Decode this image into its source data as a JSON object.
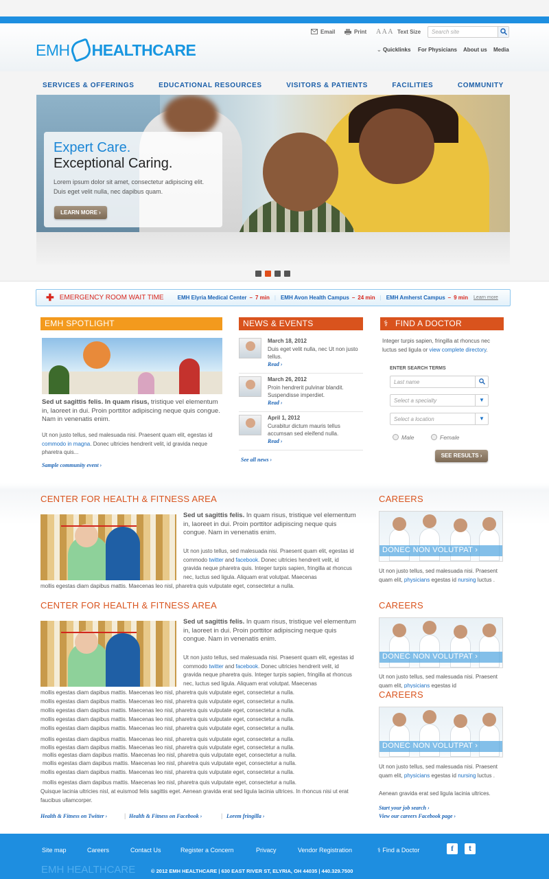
{
  "header": {
    "logo_left": "EMH",
    "logo_right": "HEALTHCARE",
    "email": "Email",
    "print": "Print",
    "text_size_glyphs": "A A A",
    "text_size": "Text Size",
    "search_placeholder": "Search site",
    "quicklinks": "Quicklinks",
    "for_physicians": "For Physicians",
    "about_us": "About us",
    "media": "Media"
  },
  "nav": [
    "SERVICES & OFFERINGS",
    "EDUCATIONAL RESOURCES",
    "VISITORS & PATIENTS",
    "FACILITIES",
    "COMMUNITY"
  ],
  "hero": {
    "title1": "Expert Care.",
    "title2": "Exceptional Caring.",
    "body": "Lorem ipsum dolor sit amet, consectetur adipiscing elit. Duis eget velit nulla, nec dapibus quam.",
    "button": "LEARN MORE",
    "slides": 4,
    "active_slide": 2
  },
  "er": {
    "title": "EMERGENCY ROOM WAIT TIME",
    "campuses": [
      {
        "name": "EMH Elyria Medical Center",
        "time": "7 min"
      },
      {
        "name": "EMH Avon Health Campus",
        "time": "24 min"
      },
      {
        "name": "EMH Amherst Campus",
        "time": "9 min"
      }
    ],
    "learn_more": "Learn more"
  },
  "spotlight": {
    "title": "EMH SPOTLIGHT",
    "lead_bold": "Sed ut sagittis felis. In quam risus,",
    "lead_rest": " tristique vel elementum in, laoreet in dui. Proin porttitor adipiscing neque quis congue. Nam in venenatis enim.",
    "body_pre": "Ut non justo tellus, sed malesuada nisi. Praesent quam elit, egestas id ",
    "body_link": "commodo in magna",
    "body_post": ". Donec ultricies hendrerit velit, id gravida neque pharetra quis...",
    "event_link": "Sample community event ›"
  },
  "news": {
    "title": "NEWS & EVENTS",
    "items": [
      {
        "date": "March 18, 2012",
        "text": "Duis eget velit nulla, nec Ut non justo tellus.",
        "read": "Read ›"
      },
      {
        "date": "March 26, 2012",
        "text": "Proin hendrerit pulvinar blandit. Suspendisse imperdiet.",
        "read": "Read ›"
      },
      {
        "date": "April 1, 2012",
        "text": "Curabitur dictum mauris tellus accumsan sed eleifend nulla.",
        "read": "Read ›"
      }
    ],
    "see_all": "See all news ›"
  },
  "doctor": {
    "title": "FIND A DOCTOR",
    "intro_pre": "Integer turpis sapien, fringilla at rhoncus nec luctus sed ligula or ",
    "intro_link": "view complete directory",
    "intro_post": ".",
    "search_terms": "ENTER SEARCH TERMS",
    "last_name": "Last name",
    "specialty": "Select a specialty",
    "location": "Select a location",
    "male": "Male",
    "female": "Female",
    "button": "SEE RESULTS"
  },
  "fitness": {
    "title": "CENTER FOR HEALTH & FITNESS AREA",
    "lead_bold": "Sed ut sagittis felis.",
    "lead_rest": " In quam risus, tristique vel elementum in, laoreet in dui. Proin porttitor adipiscing neque quis congue. Nam in venenatis enim.",
    "p_pre": "Ut non justo tellus, sed malesuada nisi. Praesent quam elit, egestas id commodo ",
    "twitter": "twitter",
    "and": " and ",
    "facebook": "facebook",
    "p_post": ". Donec ultricies hendrerit velit, id gravida neque pharetra quis. Integer turpis sapien, fringilla at rhoncus nec, luctus sed ligula. Aliquam erat volutpat. Maecenas",
    "full_line": "mollis egestas diam dapibus mattis. Maecenas leo nisl, pharetra quis vulputate eget, consectetur a nulla.",
    "tail": "Quisque lacinia ultricies nisl, at euismod felis sagittis eget. Aenean gravida erat sed ligula lacinia ultrices. In rhoncus nisi ut erat faucibus ullamcorper.",
    "links": [
      "Health & Fitness on Twitter ›",
      "Health & Fitness on Facebook ›",
      "Lorem fringilla ›"
    ]
  },
  "careers": {
    "title": "CAREERS",
    "banner": "DONEC NON VOLUTPAT ›",
    "p_pre": "Ut non justo tellus, sed malesuada nisi. Praesent quam elit, ",
    "physicians": "physicians",
    "p_mid": " egestas id ",
    "nursing": "nursing",
    "p_post": " luctus .",
    "cut": "Praesent quam elit, physicians egestas id",
    "extra": "Aenean gravida erat sed ligula lacinia ultrices.",
    "job_link": "Start your job search ›",
    "fb_link": "View our careers Facebook page ›"
  },
  "footer": {
    "links": [
      "Site map",
      "Careers",
      "Contact Us",
      "Register a Concern",
      "Privacy",
      "Vendor Registration",
      "Find a Doctor"
    ],
    "logo": "EMH HEALTHCARE",
    "copyright": "© 2012 EMH HEALTHCARE  |  630 EAST RIVER ST, ELYRIA, OH 44035  |  440.329.7500",
    "facebook_icon": "f",
    "twitter_icon": "t"
  },
  "colors": {
    "brand_blue": "#1e8ee0",
    "nav_blue": "#1a5ea8",
    "orange": "#f39a1d",
    "rust": "#d9531d",
    "emergency_red": "#d8261c"
  }
}
